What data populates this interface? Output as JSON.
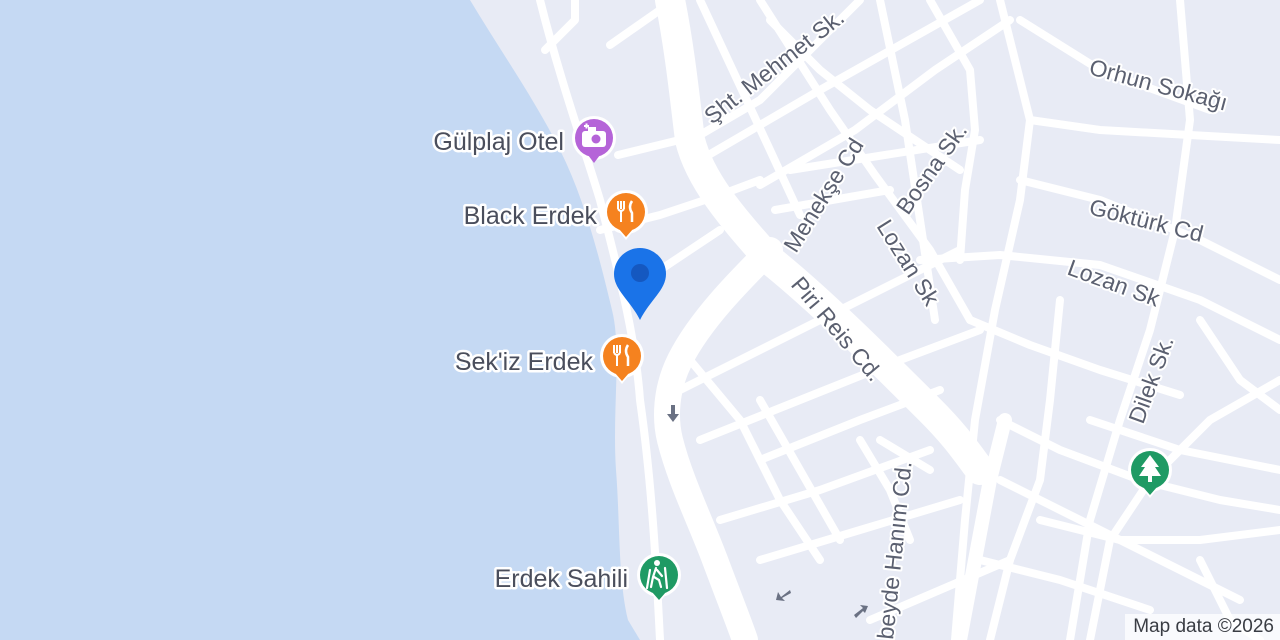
{
  "map": {
    "colors": {
      "water": "#c5d9f3",
      "land": "#e8ebf5",
      "road": "#ffffff",
      "restaurant": "#f5821f",
      "hotel": "#b564d8",
      "park": "#1f9a64",
      "location_pin": "#1a73e8"
    },
    "streets": {
      "sht_mehmet": "Şht. Mehmet Sk.",
      "orhun": "Orhun Sokağı",
      "menekse": "Menekşe Cd",
      "bosna": "Bosna Sk.",
      "lozan_1": "Lozan Sk",
      "lozan_2": "Lozan Sk",
      "gokturk": "Göktürk Cd",
      "piri_reis": "Piri Reis Cd.",
      "dilek": "Dilek Sk.",
      "seyde_hanim": "beyde Hanım Cd."
    },
    "pois": {
      "gulplaj": {
        "label": "Gülplaj Otel",
        "icon": "camera-icon"
      },
      "black_erdek": {
        "label": "Black Erdek",
        "icon": "fork-knife-icon"
      },
      "sekiz_erdek": {
        "label": "Sek'iz Erdek",
        "icon": "fork-knife-icon"
      },
      "erdek_sahili": {
        "label": "Erdek Sahili",
        "icon": "hiker-icon"
      },
      "park": {
        "icon": "tree-icon"
      }
    },
    "attribution": "Map data ©2026"
  }
}
